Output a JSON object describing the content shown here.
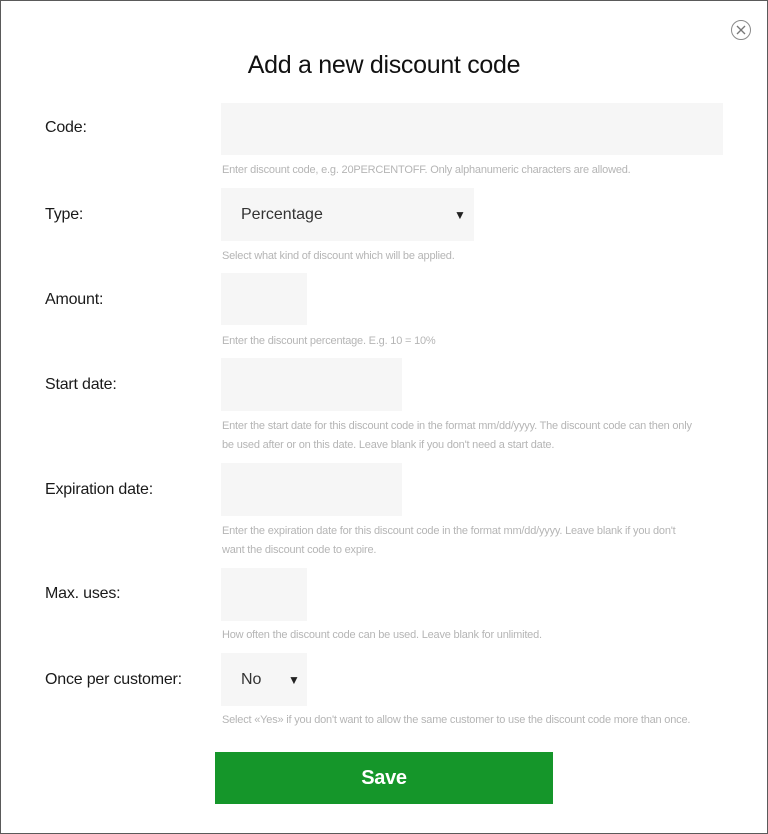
{
  "dialog": {
    "title": "Add a new discount code",
    "close_icon": "close-icon"
  },
  "form": {
    "code": {
      "label": "Code:",
      "value": "",
      "hint": "Enter discount code, e.g. 20PERCENTOFF. Only alphanumeric characters are allowed."
    },
    "type": {
      "label": "Type:",
      "value": "Percentage",
      "hint": "Select what kind of discount which will be applied."
    },
    "amount": {
      "label": "Amount:",
      "value": "",
      "hint": "Enter the discount percentage. E.g. 10 = 10%"
    },
    "start_date": {
      "label": "Start date:",
      "value": "",
      "hint_line1": "Enter the start date for this discount code in the format mm/dd/yyyy. The discount code can then only",
      "hint_line2": "be used after or on this date. Leave blank if you don't need a start date."
    },
    "expiration_date": {
      "label": "Expiration date:",
      "value": "",
      "hint_line1": "Enter the expiration date for this discount code in the format mm/dd/yyyy. Leave blank if you don't",
      "hint_line2": "want the discount code to expire."
    },
    "max_uses": {
      "label": "Max. uses:",
      "value": "",
      "hint": "How often the discount code can be used. Leave blank for unlimited."
    },
    "once_per_customer": {
      "label": "Once per customer:",
      "value": "No",
      "hint": "Select «Yes» if you don't want to allow the same customer to use the discount code more than once."
    }
  },
  "actions": {
    "save_label": "Save",
    "save_color": "#15962a"
  }
}
